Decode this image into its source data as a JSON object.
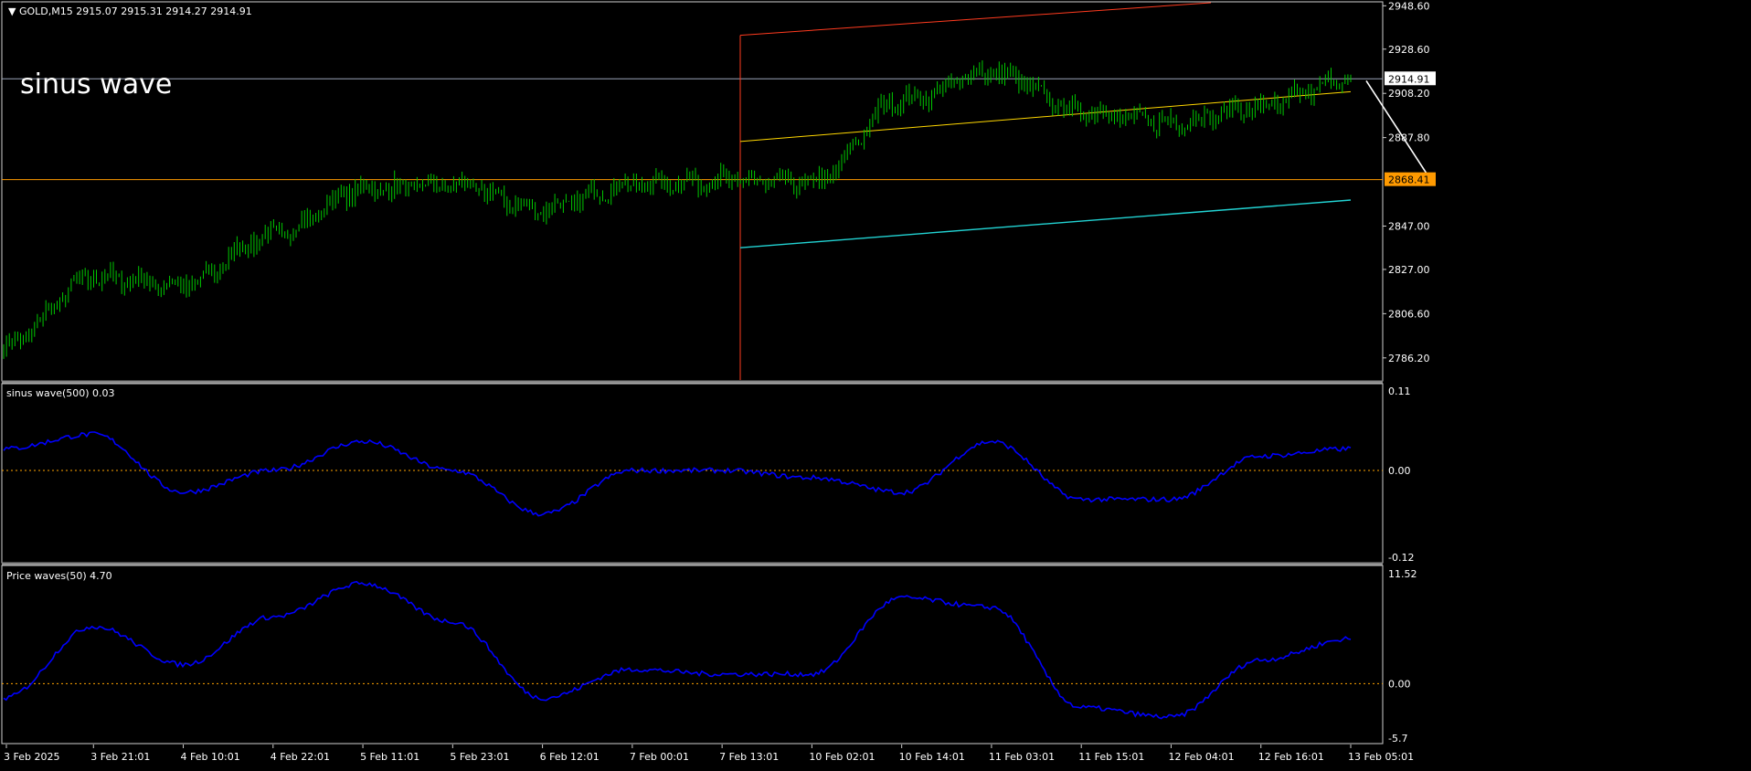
{
  "main_panel": {
    "header": "GOLD,M15  2915.07 2915.31 2914.27 2914.91",
    "overlay_text": "sinus wave",
    "price_labels": [
      "2948.60",
      "2928.60",
      "2908.20",
      "2887.80",
      "2868.41",
      "2847.00",
      "2827.00",
      "2806.60",
      "2786.20"
    ],
    "current_price_tag": "2914.91",
    "line_price_tag": "2868.41"
  },
  "sinus_panel": {
    "header": "sinus wave(500) 0.03",
    "labels": [
      "0.11",
      "0.00",
      "-0.12"
    ]
  },
  "price_wave_panel": {
    "header": "Price waves(50) 4.70",
    "labels": [
      "11.52",
      "0.00",
      "-5.7"
    ]
  },
  "time_axis": [
    "3 Feb 2025",
    "3 Feb 21:01",
    "4 Feb 10:01",
    "4 Feb 22:01",
    "5 Feb 11:01",
    "5 Feb 23:01",
    "6 Feb 12:01",
    "7 Feb 00:01",
    "7 Feb 13:01",
    "10 Feb 02:01",
    "10 Feb 14:01",
    "11 Feb 03:01",
    "11 Feb 15:01",
    "12 Feb 04:01",
    "12 Feb 16:01",
    "13 Feb 05:01"
  ],
  "colors": {
    "background": "#000000",
    "candles": "#00c800",
    "indicator_line": "#0000ff",
    "zero_line": "#ffa500",
    "horizontal_level": "#ff9a00",
    "channel_top": "#ff3b1f",
    "channel_mid": "#ffd700",
    "channel_bottom": "#22d3d3",
    "trend_arrow": "#ffffff",
    "axis_text": "#ffffff"
  },
  "chart_data": [
    {
      "type": "candlestick",
      "title": "GOLD,M15",
      "y_range": [
        2776,
        2950
      ],
      "x": [
        "3 Feb 2025",
        "3 Feb 21:01",
        "4 Feb 10:01",
        "4 Feb 22:01",
        "5 Feb 11:01",
        "5 Feb 23:01",
        "6 Feb 12:01",
        "7 Feb 00:01",
        "7 Feb 13:01",
        "10 Feb 02:01",
        "10 Feb 14:01",
        "11 Feb 03:01",
        "11 Feb 15:01",
        "12 Feb 04:01",
        "12 Feb 16:01",
        "13 Feb 05:01"
      ],
      "series": [
        {
          "values": [
            2792,
            2823,
            2820,
            2843,
            2864,
            2866,
            2855,
            2866,
            2868,
            2867,
            2905,
            2918,
            2900,
            2895,
            2902,
            2914.91
          ]
        }
      ]
    },
    {
      "type": "line",
      "title": "sinus wave(500) 0.03",
      "y_range": [
        -0.12,
        0.11
      ],
      "x": [
        "3 Feb 2025",
        "3 Feb 21:01",
        "4 Feb 10:01",
        "4 Feb 22:01",
        "5 Feb 11:01",
        "5 Feb 23:01",
        "6 Feb 12:01",
        "7 Feb 00:01",
        "7 Feb 13:01",
        "10 Feb 02:01",
        "10 Feb 14:01",
        "11 Feb 03:01",
        "11 Feb 15:01",
        "12 Feb 04:01",
        "12 Feb 16:01",
        "13 Feb 05:01"
      ],
      "series": [
        {
          "values": [
            0.03,
            0.05,
            -0.03,
            0.0,
            0.04,
            0.0,
            -0.06,
            0.0,
            0.0,
            -0.01,
            -0.03,
            0.04,
            -0.04,
            -0.04,
            0.02,
            0.03
          ]
        }
      ]
    },
    {
      "type": "line",
      "title": "Price waves(50) 4.70",
      "y_range": [
        -5.7,
        11.52
      ],
      "x": [
        "3 Feb 2025",
        "3 Feb 21:01",
        "4 Feb 10:01",
        "4 Feb 22:01",
        "5 Feb 11:01",
        "5 Feb 23:01",
        "6 Feb 12:01",
        "7 Feb 00:01",
        "7 Feb 13:01",
        "10 Feb 02:01",
        "10 Feb 14:01",
        "11 Feb 03:01",
        "11 Feb 15:01",
        "12 Feb 04:01",
        "12 Feb 16:01",
        "13 Feb 05:01"
      ],
      "series": [
        {
          "values": [
            -1.5,
            6.0,
            2.0,
            7.0,
            10.5,
            6.5,
            -1.5,
            1.5,
            1.0,
            1.0,
            9.0,
            8.0,
            -2.5,
            -3.5,
            2.5,
            4.7
          ]
        }
      ]
    }
  ]
}
